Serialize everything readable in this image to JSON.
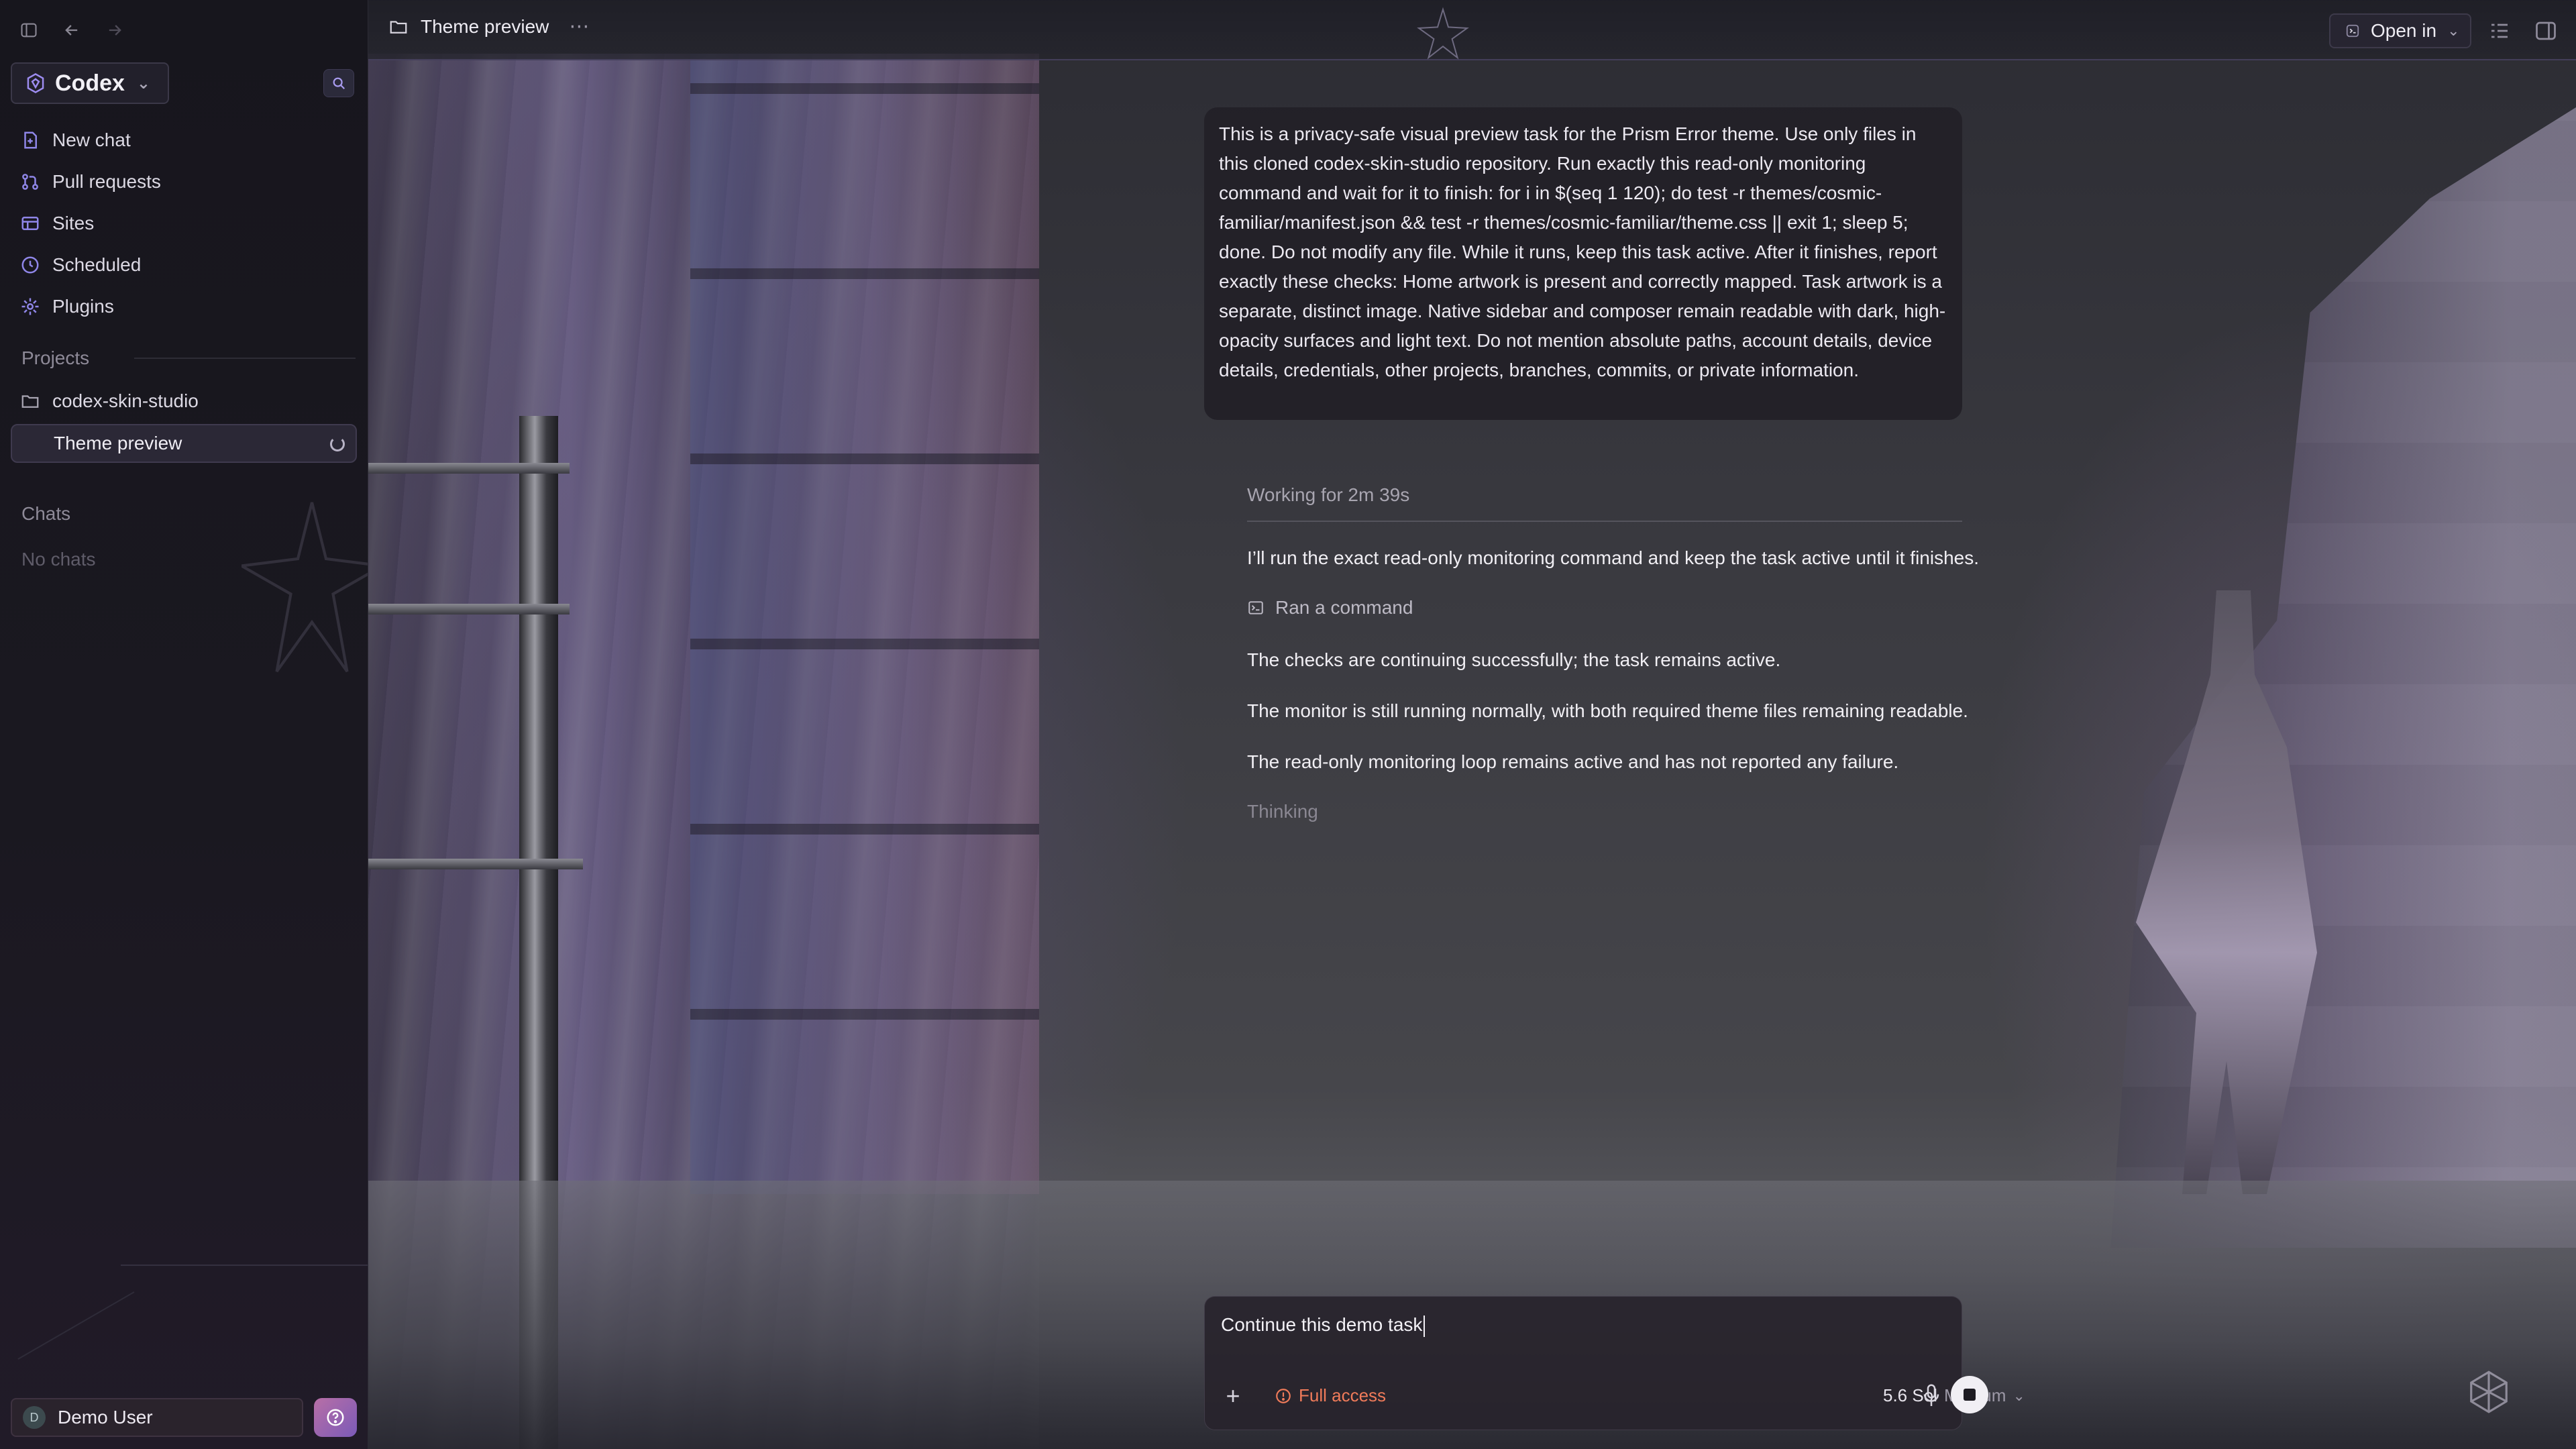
{
  "sidebar": {
    "brand": "Codex",
    "nav": [
      {
        "label": "New chat",
        "icon": "new-chat-icon"
      },
      {
        "label": "Pull requests",
        "icon": "pull-request-icon"
      },
      {
        "label": "Sites",
        "icon": "sites-icon"
      },
      {
        "label": "Scheduled",
        "icon": "clock-icon"
      },
      {
        "label": "Plugins",
        "icon": "plugins-icon"
      }
    ],
    "projects_label": "Projects",
    "project": "codex-skin-studio",
    "task": "Theme preview",
    "chats_label": "Chats",
    "no_chats": "No chats",
    "user_initial": "D",
    "user_name": "Demo User"
  },
  "header": {
    "title": "Theme preview",
    "open_in": "Open in"
  },
  "conversation": {
    "user_message": "This is a privacy-safe visual preview task for the Prism Error theme. Use only files in this cloned codex-skin-studio repository. Run exactly this read-only monitoring command and wait for it to finish: for i in $(seq 1 120); do test -r themes/cosmic-familiar/manifest.json && test -r themes/cosmic-familiar/theme.css || exit 1; sleep 5; done. Do not modify any file. While it runs, keep this task active. After it finishes, report exactly these checks: Home artwork is present and correctly mapped. Task artwork is a separate, distinct image. Native sidebar and composer remain readable with dark, high-opacity surfaces and light text. Do not mention absolute paths, account details, device details, credentials, other projects, branches, commits, or private information.",
    "working": "Working for 2m 39s",
    "messages": [
      "I’ll run the exact read-only monitoring command and keep the task active until it finishes.",
      "The checks are continuing successfully; the task remains active.",
      "The monitor is still running normally, with both required theme files remaining readable.",
      "The read-only monitoring loop remains active and has not reported any failure."
    ],
    "ran_command": "Ran a command",
    "thinking": "Thinking"
  },
  "composer": {
    "value": "Continue this demo task",
    "access": "Full access",
    "model": "5.6 Sol",
    "effort": "Medium"
  },
  "colors": {
    "accent_warning": "#f07b5a",
    "sidebar_bg": "#17161d",
    "help_gradient_start": "#b86fa6",
    "help_gradient_end": "#7b5ab8"
  }
}
